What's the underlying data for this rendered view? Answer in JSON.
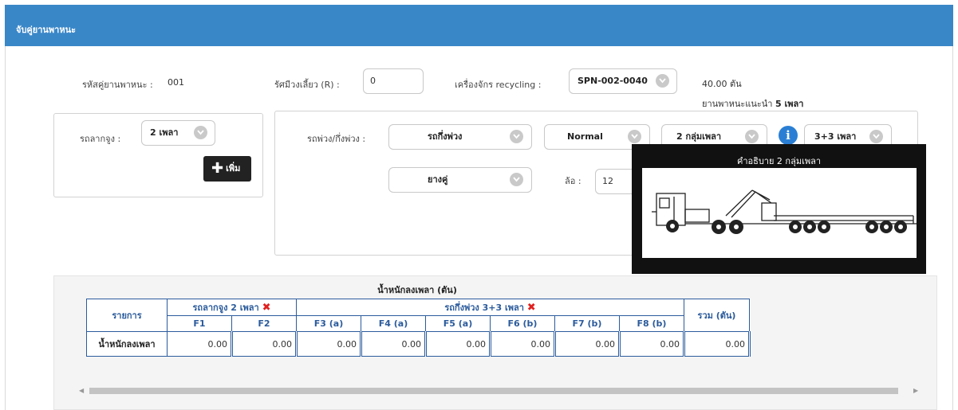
{
  "header": {
    "title": "จับคู่ยานพาหนะ"
  },
  "vehicle_code": {
    "label": "รหัสคู่ยานพาหนะ :",
    "value": "001"
  },
  "turn_radius": {
    "label": "รัศมีวงเลี้ยว (R) :",
    "value": "0"
  },
  "machine": {
    "label": "เครื่องจักร recycling :",
    "value": "SPN-002-0040"
  },
  "weight_info": {
    "weight": "40.00 ตัน",
    "recommend_label": "ยานพาหนะแนะนำ",
    "recommend_value": "5 เพลา"
  },
  "tractor": {
    "label": "รถลากจูง :",
    "axle_value": "2 เพลา",
    "add_label": "เพิ่ม"
  },
  "trailer": {
    "label": "รถพ่วง/กึ่งพ่วง :",
    "type_value": "รถกึ่งพ่วง",
    "mode_value": "Normal",
    "group_value": "2 กลุ่มเพลา",
    "axle_config_value": "3+3 เพลา",
    "tire_value": "ยางคู่",
    "wheel_label": "ล้อ :",
    "wheel_value": "12"
  },
  "tooltip": {
    "title": "คำอธิบาย 2 กลุ่มเพลา"
  },
  "table": {
    "caption": "น้ำหนักลงเพลา (ตัน)",
    "item_header": "รายการ",
    "tractor_group": "รถลากจูง 2 เพลา",
    "trailer_group": "รถกึ่งพ่วง 3+3 เพลา",
    "total_header": "รวม (ตัน)",
    "columns": [
      "F1",
      "F2",
      "F3 (a)",
      "F4 (a)",
      "F5 (a)",
      "F6 (b)",
      "F7 (b)",
      "F8 (b)"
    ],
    "row_label": "น้ำหนักลงเพลา",
    "values": [
      "0.00",
      "0.00",
      "0.00",
      "0.00",
      "0.00",
      "0.00",
      "0.00",
      "0.00"
    ],
    "total_value": "0.00"
  },
  "colors": {
    "header_bg": "#3a87c8",
    "table_border": "#2b5b9c",
    "remove_icon": "#e02020",
    "info_icon": "#2a7fd4"
  }
}
